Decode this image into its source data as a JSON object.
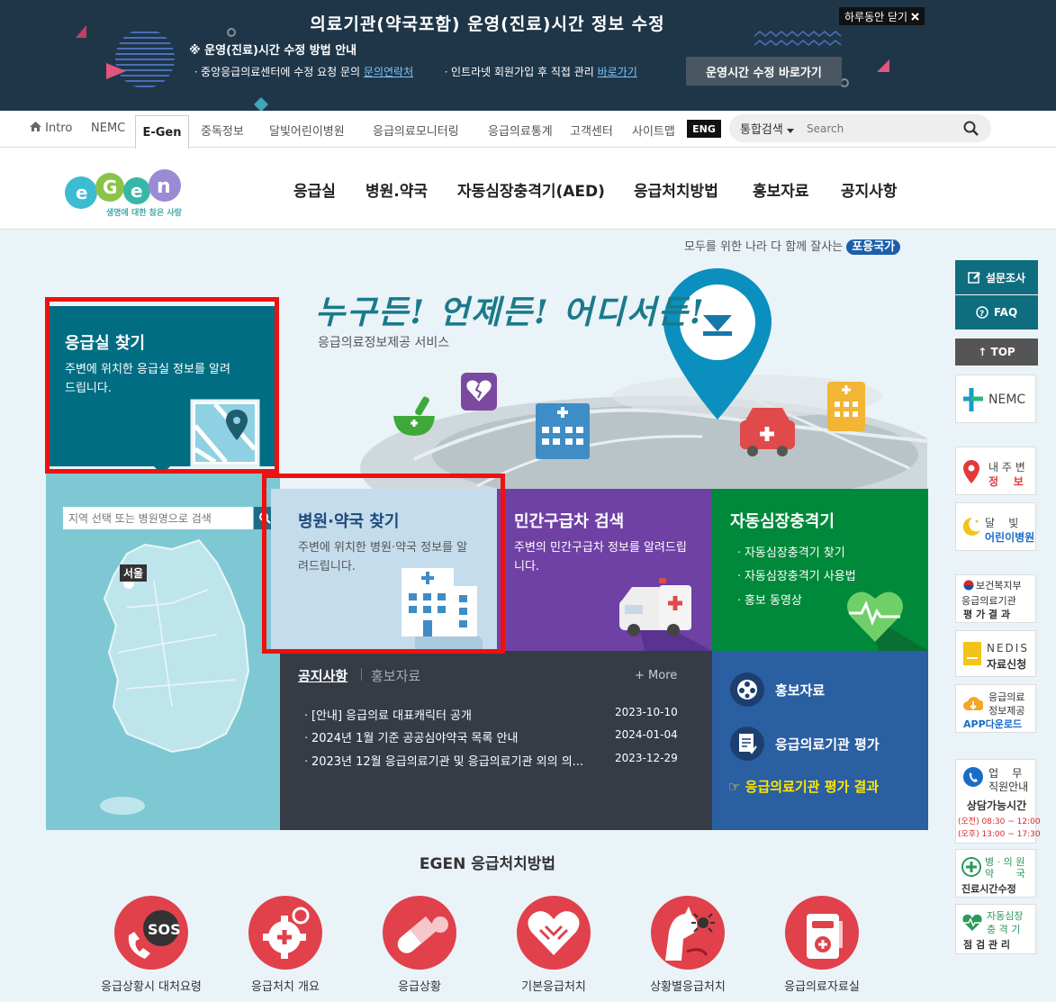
{
  "notice": {
    "title": "의료기관(약국포함) 운영(진료)시간 정보 수정",
    "subtitle": "※ 운영(진료)시간 수정 방법 안내",
    "line1_prefix": "ㆍ중앙응급의료센터에 수정 요청 문의 ",
    "line1_link": "문의연락처",
    "line2_prefix": "ㆍ인트라넷 회원가입 후 직접 관리 ",
    "line2_link": "바로가기",
    "button": "운영시간 수정 바로가기",
    "close_label": "하루동안 닫기"
  },
  "util_nav": {
    "intro": "Intro",
    "nemc": "NEMC",
    "egen": "E-Gen",
    "poison": "중독정보",
    "moonlight": "달빛어린이병원",
    "monitor": "응급의료모니터링",
    "stats": "응급의료통계",
    "customer": "고객센터",
    "sitemap": "사이트맵",
    "eng": "ENG",
    "search_scope": "통합검색",
    "search_placeholder": "Search"
  },
  "logo": {
    "tagline": "생명에 대한 참은 사랑"
  },
  "gnb": [
    "응급실",
    "병원.약국",
    "자동심장충격기(AED)",
    "응급처치방법",
    "홍보자료",
    "공지사항"
  ],
  "slogan": {
    "text": "모두를 위한 나라 다 함께 잘사는 ",
    "badge": "포용국가"
  },
  "hero": {
    "headline": "누구든! 언제든! 어디서든!",
    "sub": "응급의료정보제공 서비스"
  },
  "er": {
    "title": "응급실 찾기",
    "desc": "주변에 위치한 응급실 정보를 알려드립니다."
  },
  "map": {
    "placeholder": "지역 선택 또는 병원명으로 검색",
    "seoul": "서울"
  },
  "hospital": {
    "title": "병원·약국 찾기",
    "desc": "주변에 위치한 병원·약국 정보를 알려드립니다."
  },
  "ambulance": {
    "title": "민간구급차 검색",
    "desc": "주변의 민간구급차 정보를 알려드립니다."
  },
  "aed": {
    "title": "자동심장충격기",
    "items": [
      "ㆍ자동심장충격기 찾기",
      "ㆍ자동심장충격기 사용법",
      "ㆍ홍보 동영상"
    ]
  },
  "board": {
    "tab_notice": "공지사항",
    "tab_promo": "홍보자료",
    "more": "+ More",
    "rows": [
      {
        "title": "ㆍ[안내] 응급의료 대표캐릭터 공개",
        "date": "2023-10-10"
      },
      {
        "title": "ㆍ2024년 1월 기준 공공심야약국 목록 안내",
        "date": "2024-01-04"
      },
      {
        "title": "ㆍ2023년 12월 응급의료기관 및 응급의료기관 외의 의...",
        "date": "2023-12-29"
      }
    ]
  },
  "promo": {
    "item1": "홍보자료",
    "item2": "응급의료기관 평가",
    "eval_link": "☞ 응급의료기관 평가 결과"
  },
  "rail": {
    "survey": "설문조사",
    "faq": "FAQ",
    "top": "↑ TOP",
    "nemc": "NEMC",
    "nearby_1": "내 주 변",
    "nearby_2": "정    보",
    "moon_1": "달    빛",
    "moon_2": "어린이병원",
    "mohw_1": "보건복지부",
    "mohw_2": "응급의료기관",
    "mohw_3": "평 가 결 과",
    "nedis_1": "NEDIS",
    "nedis_2": "자료신청",
    "app_1": "응급의료",
    "app_2": "정보제공",
    "app_3": "APP다운로드",
    "work_1": "업    무",
    "work_2": "직원안내",
    "work_3": "상담가능시간",
    "work_4": "(오전) 08:30 ~ 12:00",
    "work_5": "(오후) 13:00 ~ 17:30",
    "hours_1": "병 · 의 원",
    "hours_2": "약       국",
    "hours_3": "진료시간수정",
    "aedm_1": "자동심장",
    "aedm_2": "충 격 기",
    "aedm_3": "점 검 관 리"
  },
  "first_aid": {
    "title": "EGEN 응급처치방법",
    "items": [
      "응급상황시 대처요령",
      "응급처치 개요",
      "응급상황",
      "기본응급처치",
      "상황별응급처치",
      "응급의료자료실"
    ]
  },
  "colors": {
    "banner_bg": "#1f3649",
    "er_teal": "#006d82",
    "hospital_blue": "#c4dcec",
    "ambulance_purple": "#6f41a4",
    "aed_green": "#00893b",
    "notice_dark": "#363c46",
    "promo_blue": "#2a5fa1",
    "highlight_red": "#ee1111"
  }
}
